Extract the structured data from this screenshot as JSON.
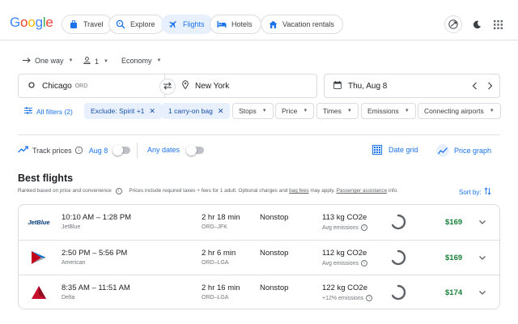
{
  "header": {
    "logo_letters": [
      {
        "ch": "G",
        "color": "#4285F4"
      },
      {
        "ch": "o",
        "color": "#EA4335"
      },
      {
        "ch": "o",
        "color": "#FBBC05"
      },
      {
        "ch": "g",
        "color": "#4285F4"
      },
      {
        "ch": "l",
        "color": "#34A853"
      },
      {
        "ch": "e",
        "color": "#EA4335"
      }
    ],
    "tabs": {
      "travel": "Travel",
      "explore": "Explore",
      "flights": "Flights",
      "hotels": "Hotels",
      "vacation": "Vacation rentals"
    },
    "active_tab": "flights"
  },
  "search": {
    "trip_type": "One way",
    "passengers": "1",
    "cabin": "Economy",
    "origin": "Chicago",
    "origin_code": "ORD",
    "destination": "New York",
    "date": "Thu, Aug 8"
  },
  "filters": {
    "all_filters": "All filters (2)",
    "exclude": "Exclude: Spirit +1",
    "carry_on": "1 carry-on bag",
    "stops": "Stops",
    "price": "Price",
    "times": "Times",
    "emissions": "Emissions",
    "connecting": "Connecting airports"
  },
  "track": {
    "label": "Track prices",
    "date": "Aug 8",
    "any_dates": "Any dates",
    "date_grid": "Date grid",
    "price_graph": "Price graph"
  },
  "results": {
    "title": "Best flights",
    "subtitle_a": "Ranked based on price and convenience",
    "subtitle_b": "Prices include required taxes + fees for 1 adult. Optional charges and",
    "bag_fees": "bag fees",
    "subtitle_c": "may apply.",
    "passenger_assistance": "Passenger assistance",
    "subtitle_d": "info.",
    "sort_by": "Sort by:",
    "flights": [
      {
        "logo_text": "JetBlue",
        "times": "10:10 AM – 1:28 PM",
        "airline": "JetBlue",
        "duration": "2 hr 18 min",
        "route": "ORD–JFK",
        "stops": "Nonstop",
        "co2": "113 kg CO2e",
        "emissions": "Avg emissions",
        "price": "$169"
      },
      {
        "logo_text": "",
        "times": "2:50 PM – 5:56 PM",
        "airline": "American",
        "duration": "2 hr 6 min",
        "route": "ORD–LGA",
        "stops": "Nonstop",
        "co2": "112 kg CO2e",
        "emissions": "Avg emissions",
        "price": "$169"
      },
      {
        "logo_text": "",
        "times": "8:35 AM – 11:51 AM",
        "airline": "Delta",
        "duration": "2 hr 16 min",
        "route": "ORD–LGA",
        "stops": "Nonstop",
        "co2": "122 kg CO2e",
        "emissions": "+12% emissions",
        "price": "$174"
      }
    ]
  },
  "colors": {
    "accent": "#1a73e8",
    "price_green": "#188038",
    "jetblue": "#003876",
    "delta_red": "#C8102E",
    "american_red": "#C30019",
    "american_blue": "#0078D2"
  }
}
